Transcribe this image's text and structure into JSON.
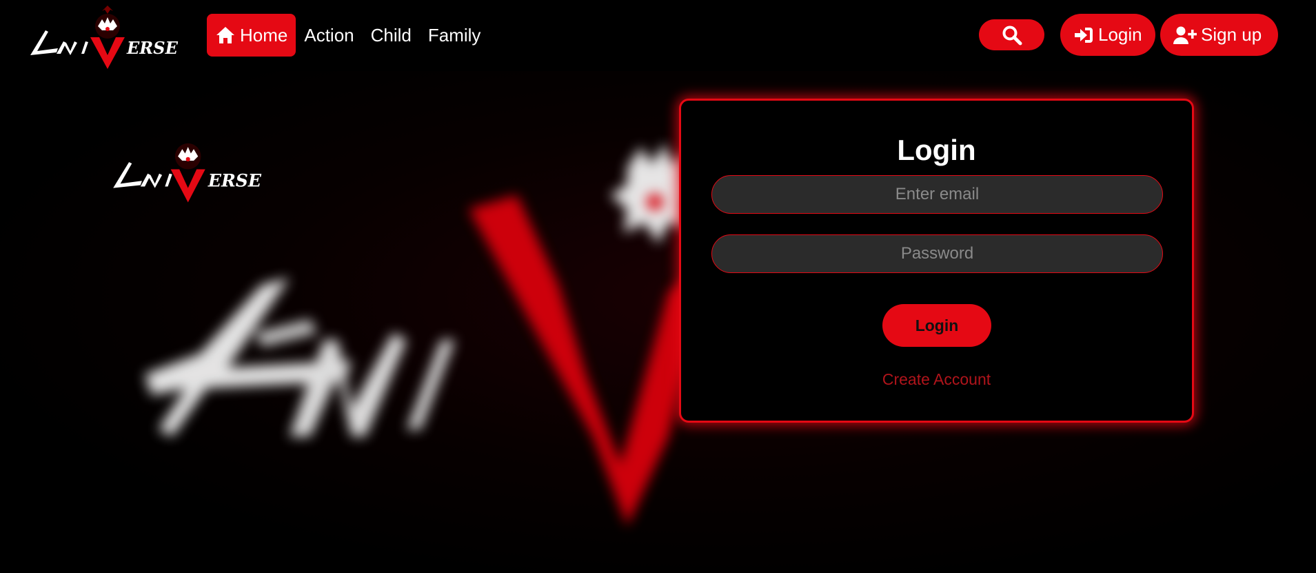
{
  "brand": {
    "logo_text": "AniVerse",
    "accent": "#e50914"
  },
  "nav": {
    "links": [
      {
        "label": "Home",
        "icon": "home-icon",
        "active": true
      },
      {
        "label": "Action"
      },
      {
        "label": "Child"
      },
      {
        "label": "Family"
      }
    ],
    "search_icon": "search-icon",
    "login_label": "Login",
    "login_icon": "sign-in-icon",
    "signup_label": "Sign up",
    "signup_icon": "user-plus-icon"
  },
  "login_form": {
    "title": "Login",
    "email_placeholder": "Enter email",
    "password_placeholder": "Password",
    "submit_label": "Login",
    "create_account_label": "Create Account"
  }
}
